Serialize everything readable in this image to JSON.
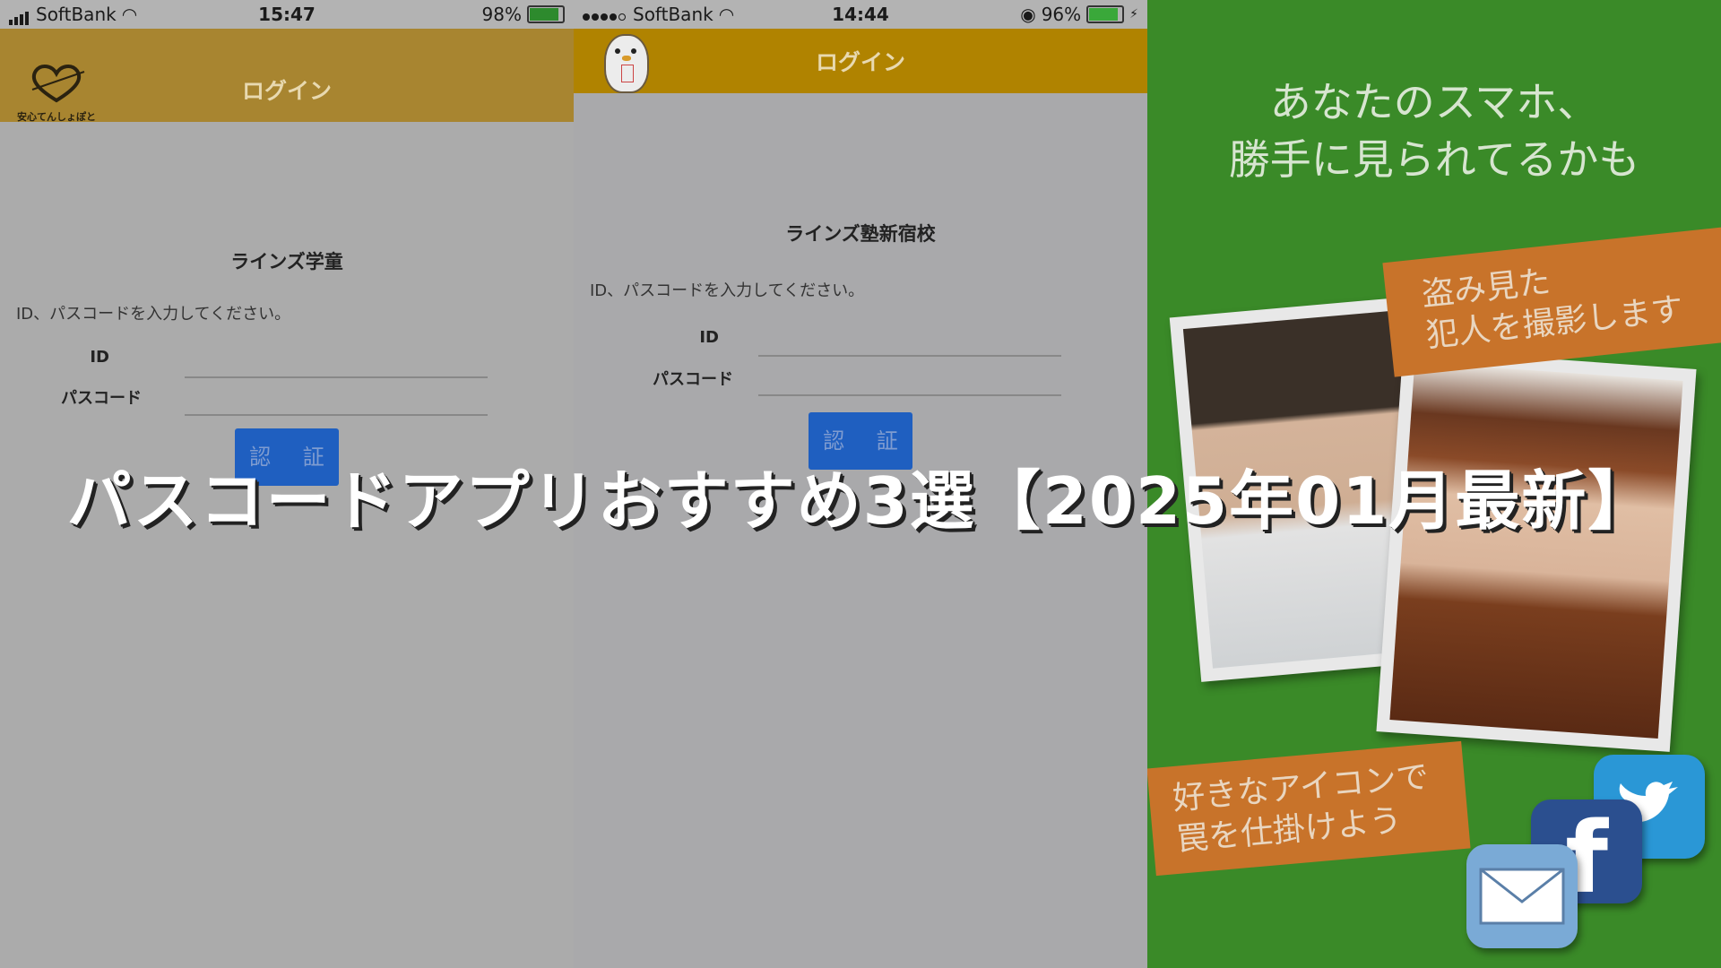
{
  "panel1": {
    "status": {
      "carrier": "SoftBank",
      "time": "15:47",
      "battery": "98%",
      "battery_level": 0.98
    },
    "app_title": "ログイン",
    "logo_text": "安心てんしょぽと",
    "form_title": "ラインズ学童",
    "instruction": "ID、パスコードを入力してください。",
    "id_label": "ID",
    "passcode_label": "パスコード",
    "submit": "認 証"
  },
  "panel2": {
    "status": {
      "carrier": "SoftBank",
      "time": "14:44",
      "battery": "96%",
      "battery_level": 0.96
    },
    "app_title": "ログイン",
    "form_title": "ラインズ塾新宿校",
    "instruction": "ID、パスコードを入力してください。",
    "id_label": "ID",
    "passcode_label": "パスコード",
    "submit": "認 証"
  },
  "panel3": {
    "headline_1": "あなたのスマホ、",
    "headline_2": "勝手に見られてるかも",
    "tag1_line1": "盗み見た",
    "tag1_line2": "犯人を撮影します",
    "tag2_line1": "好きなアイコンで",
    "tag2_line2": "罠を仕掛けよう",
    "icons": [
      "twitter-icon",
      "facebook-icon",
      "mail-icon"
    ],
    "colors": {
      "background": "#3a8a28",
      "tag": "#c8732a",
      "twitter": "#2a97d6",
      "facebook": "#2b4f8f",
      "mail": "#7aaad6"
    }
  },
  "overlay_title": "パスコードアプリおすすめ3選【2025年01月最新】"
}
